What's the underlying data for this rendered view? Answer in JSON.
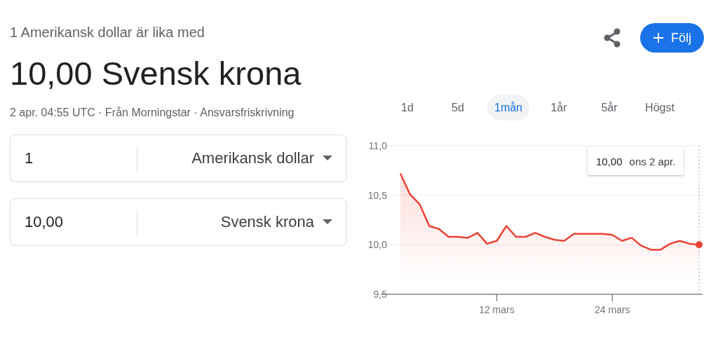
{
  "header": {
    "subtitle": "1 Amerikansk dollar är lika med",
    "result": "10,00 Svensk krona",
    "meta": "2 apr. 04:55 UTC · Från Morningstar · Ansvarsfriskrivning"
  },
  "follow_button": {
    "label": "Följ"
  },
  "converter": [
    {
      "amount": "1",
      "currency": "Amerikansk dollar"
    },
    {
      "amount": "10,00",
      "currency": "Svensk krona"
    }
  ],
  "range_tabs": [
    {
      "label": "1d",
      "selected": false
    },
    {
      "label": "5d",
      "selected": false
    },
    {
      "label": "1mån",
      "selected": true
    },
    {
      "label": "1år",
      "selected": false
    },
    {
      "label": "5år",
      "selected": false
    },
    {
      "label": "Högst",
      "selected": false
    }
  ],
  "chart": {
    "chart_data": {
      "type": "area",
      "categories": [
        null,
        null,
        null,
        null,
        null,
        null,
        null,
        null,
        null,
        null,
        "12 mars",
        null,
        null,
        null,
        null,
        null,
        null,
        null,
        null,
        null,
        null,
        null,
        "24 mars",
        null,
        null,
        null,
        null,
        null,
        null,
        null,
        null,
        null
      ],
      "ylim": [
        9.5,
        11
      ],
      "series": [
        {
          "color": "#ea4335",
          "values": [
            10.72,
            10.51,
            10.41,
            10.19,
            10.16,
            10.08,
            10.08,
            10.07,
            10.12,
            10.01,
            10.04,
            10.19,
            10.08,
            10.08,
            10.12,
            10.08,
            10.05,
            10.04,
            10.11,
            10.11,
            10.11,
            10.11,
            10.1,
            10.04,
            10.07,
            9.99,
            9.95,
            9.95,
            10.01,
            10.04,
            10.01,
            10.0
          ]
        }
      ],
      "yticks": [
        {
          "value": 9.5,
          "label": "9,5"
        },
        {
          "value": 10,
          "label": "10,0"
        },
        {
          "value": 10.5,
          "label": "10,5"
        },
        {
          "value": 11,
          "label": "11,0"
        }
      ]
    },
    "tooltip": {
      "value": "10,00",
      "date": "ons 2 apr."
    }
  }
}
